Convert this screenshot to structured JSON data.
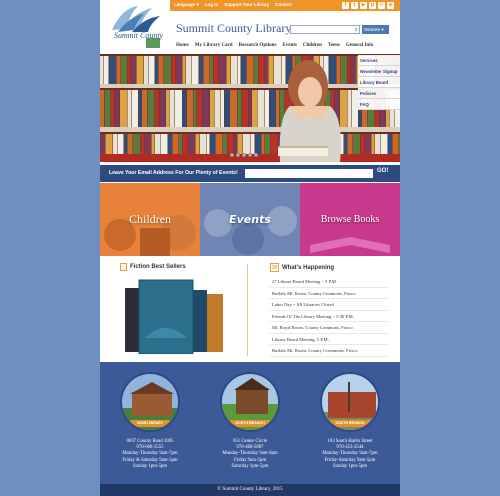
{
  "top_links": [
    "Language ▾",
    "Log In",
    "Support Your Library",
    "Contact"
  ],
  "social_icons": [
    "facebook-icon",
    "twitter-icon",
    "youtube-icon",
    "pinterest-icon",
    "email-icon",
    "rss-icon"
  ],
  "site": {
    "title": "Summit County Library",
    "logo_text": "Summit County"
  },
  "search": {
    "placeholder": "",
    "select_label": "Website ▾"
  },
  "nav": [
    "Home",
    "My Library Card",
    "Research Options",
    "Events",
    "Children",
    "Teens",
    "General Info"
  ],
  "side_menu": [
    "Services",
    "Newsletter Signup",
    "Library Board",
    "Policies",
    "FAQ"
  ],
  "email_bar": {
    "label": "Leave Your Email Address For Our Plenty of Events!",
    "go": "GO!"
  },
  "tiles": [
    {
      "label": "Children",
      "color": "#e8823a"
    },
    {
      "label": "Events",
      "color": "#6f86b4"
    },
    {
      "label": "Browse Books",
      "color": "#c8388c"
    }
  ],
  "fiction": {
    "title": "Fiction Best Sellers"
  },
  "happening": {
    "title": "What's Happening",
    "calendar_day": "30",
    "events": [
      "27 Library Board Meeting ~ 5 P.M.",
      "Buffalo Mt. Room, County Commons, Frisco",
      "Labor Day ~ All Libraries Closed",
      "Friends Of The Library Meeting ~ 5:30 P.M.",
      "Mt. Royal Room, County Commons, Frisco",
      "Library Board Meeting, 5 P.M.,",
      "Buffalo Mt. Room, County Ccommons, Frisco"
    ]
  },
  "branches": [
    {
      "badge": "MAIN LIBRARY",
      "address": "0037 County Road 1005",
      "phone": "970-668-5555",
      "hours1": "Monday-Thursday 9am-7pm",
      "hours2": "Friday & Saturday 9am-5pm",
      "hours3": "Sunday 1pm-5pm"
    },
    {
      "badge": "NORTH BRANCH",
      "address": "651 Center Circle",
      "phone": "970-468-5887",
      "hours1": "Monday-Thursday 9am-6pm",
      "hours2": "Friday 9am-5pm",
      "hours3": "Saturday 1pm-5pm"
    },
    {
      "badge": "SOUTH BRANCH",
      "address": "103 South Harris Street",
      "phone": "970-453-3544",
      "hours1": "Monday-Thursday 9am-7pm",
      "hours2": "Friday-Saturday 9am-5pm",
      "hours3": "Sunday 1pm-5pm"
    }
  ],
  "footer": "© Summit County Library, 2015",
  "colors": {
    "accent": "#f0952a",
    "nav_blue": "#3c5998",
    "title_blue": "#3c5aa0",
    "background": "#6d8fc1"
  }
}
